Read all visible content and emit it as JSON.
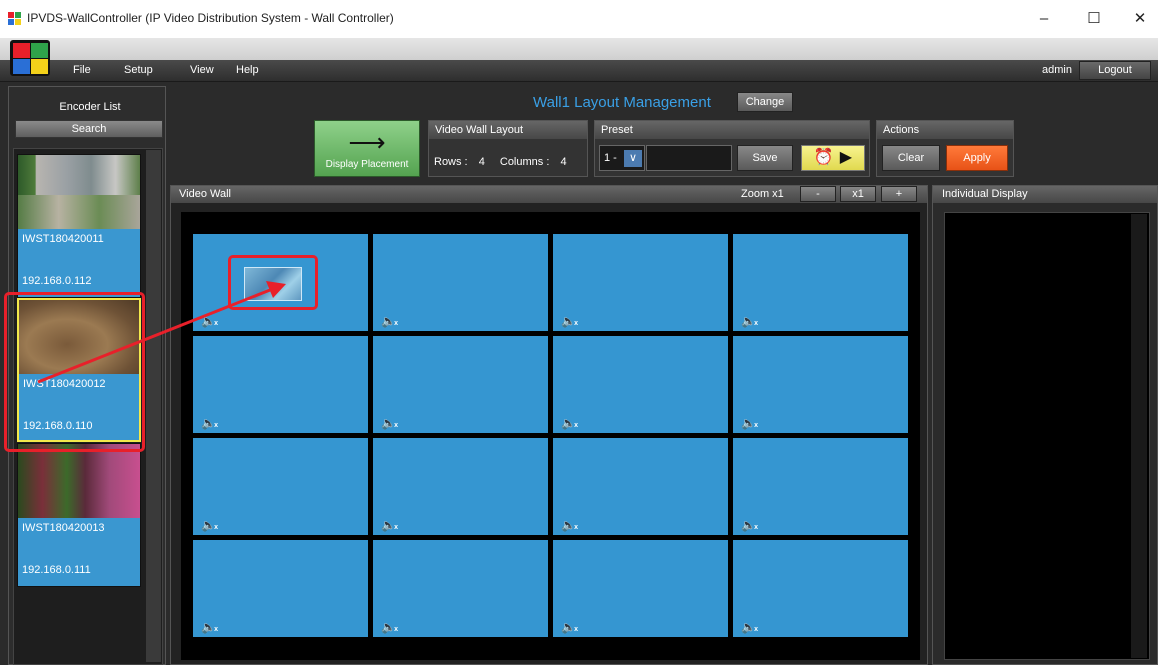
{
  "window": {
    "title": "IPVDS-WallController (IP Video Distribution System - Wall Controller)",
    "minimize": "–",
    "maximize": "☐",
    "close": "✕"
  },
  "menu": {
    "file": "File",
    "setup": "Setup",
    "view": "View",
    "help": "Help"
  },
  "user": {
    "name": "admin",
    "logout": "Logout"
  },
  "encoder_panel": {
    "title": "Encoder List",
    "search": "Search",
    "encoders": [
      {
        "name": "IWST180420011",
        "ip": "192.168.0.112"
      },
      {
        "name": "IWST180420012",
        "ip": "192.168.0.110"
      },
      {
        "name": "IWST180420013",
        "ip": "192.168.0.111"
      }
    ]
  },
  "header": {
    "layout_title": "Wall1 Layout Management",
    "change": "Change",
    "display_placement": "Display Placement",
    "video_wall_layout": {
      "title": "Video Wall Layout",
      "rows_label": "Rows :",
      "rows": "4",
      "columns_label": "Columns :",
      "columns": "4"
    },
    "preset": {
      "title": "Preset",
      "selected": "1 -",
      "save": "Save"
    },
    "actions": {
      "title": "Actions",
      "clear": "Clear",
      "apply": "Apply"
    }
  },
  "video_wall": {
    "title": "Video Wall",
    "zoom_label": "Zoom x1",
    "zoom_minus": "-",
    "zoom_reset": "x1",
    "zoom_plus": "+"
  },
  "individual_display": {
    "title": "Individual Display"
  },
  "colors": {
    "cell": "#3596d1",
    "accent_blue": "#3aa0e6",
    "apply_orange": "#e85217",
    "highlight_red": "#e8202a",
    "selection_yellow": "#f3e94b"
  }
}
